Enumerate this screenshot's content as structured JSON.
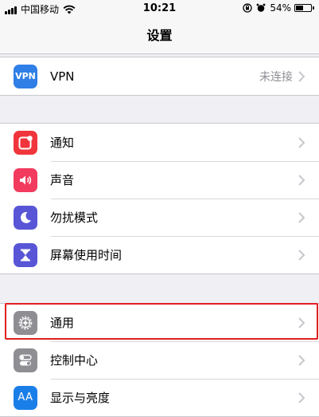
{
  "status_bar": {
    "carrier": "中国移动",
    "time": "10:21",
    "battery": "54%",
    "battery_level": 0.54
  },
  "nav": {
    "title": "设置"
  },
  "groups": [
    {
      "rows": [
        {
          "label": "VPN",
          "icon": "vpn-icon",
          "icon_text": "VPN",
          "color": "#2f7fe6",
          "detail": "未连接"
        }
      ]
    },
    {
      "rows": [
        {
          "label": "通知",
          "icon": "notifications-icon",
          "color": "#f0353c"
        },
        {
          "label": "声音",
          "icon": "sound-icon",
          "color": "#f23a5e"
        },
        {
          "label": "勿扰模式",
          "icon": "moon-icon",
          "color": "#5856d6"
        },
        {
          "label": "屏幕使用时间",
          "icon": "hourglass-icon",
          "color": "#5856d6"
        }
      ]
    },
    {
      "rows": [
        {
          "label": "通用",
          "icon": "gear-icon",
          "color": "#8e8e93"
        },
        {
          "label": "控制中心",
          "icon": "toggles-icon",
          "color": "#8e8e93"
        },
        {
          "label": "显示与亮度",
          "icon": "display-brightness-icon",
          "icon_text": "AA",
          "color": "#1a7ee8"
        }
      ]
    }
  ],
  "colors": {
    "highlight": "#e02020",
    "background": "#efeff4"
  }
}
